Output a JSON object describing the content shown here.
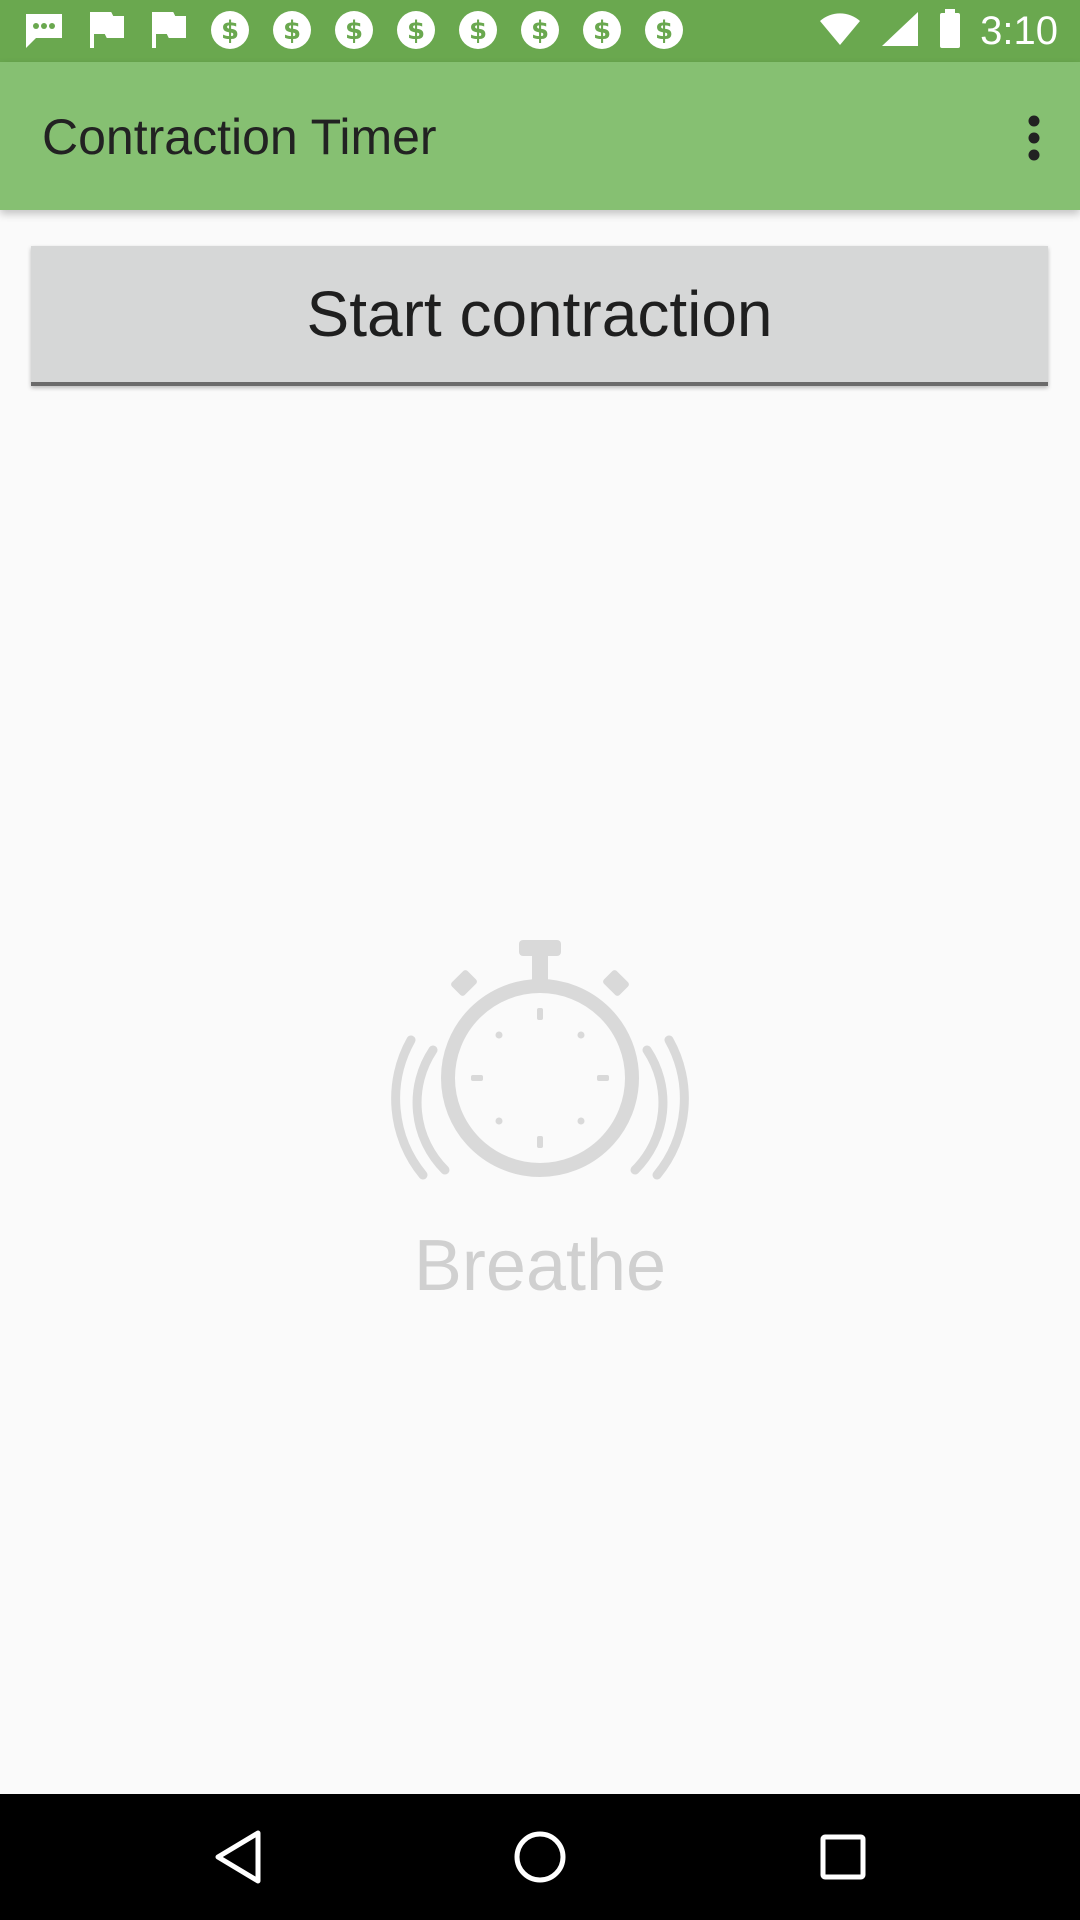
{
  "status_bar": {
    "time": "3:10",
    "notification_icons": [
      "messaging-icon",
      "flag-icon",
      "flag-icon",
      "money-icon",
      "money-icon",
      "money-icon",
      "money-icon",
      "money-icon",
      "money-icon",
      "money-icon",
      "money-icon"
    ]
  },
  "app_bar": {
    "title": "Contraction Timer",
    "overflow_icon": "more-vert-icon"
  },
  "main": {
    "start_button_label": "Start contraction",
    "illustration_icon": "stopwatch-icon",
    "breathe_text": "Breathe"
  },
  "nav_bar": {
    "back_icon": "back-icon",
    "home_icon": "home-icon",
    "recents_icon": "recents-icon"
  },
  "colors": {
    "status_bar": "#6aa84f",
    "app_bar": "#86c072",
    "button_bg": "#d6d7d7",
    "background": "#fafafa"
  }
}
